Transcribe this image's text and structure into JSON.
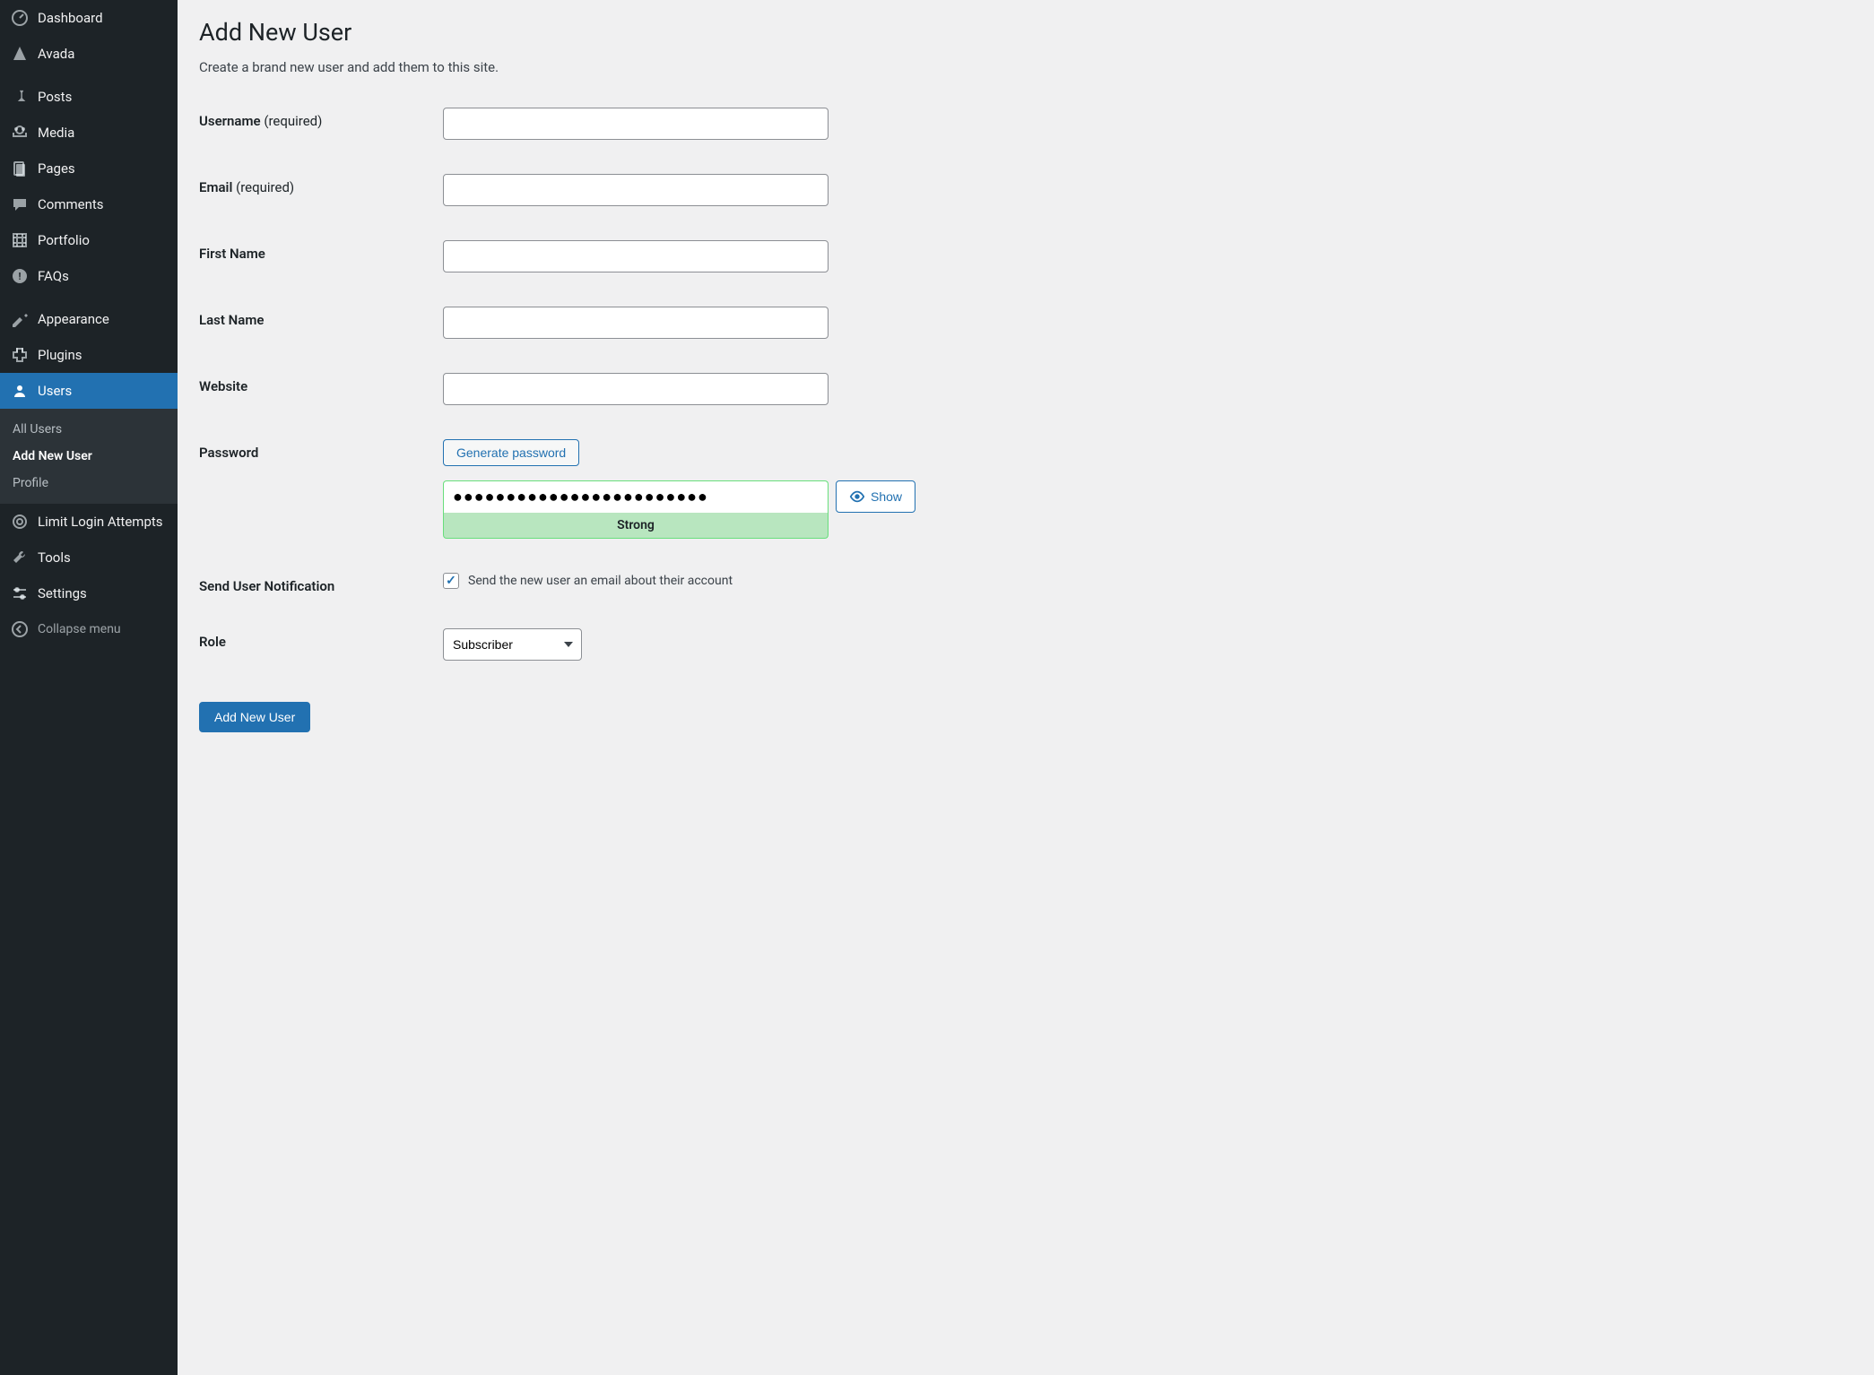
{
  "sidebar": {
    "items": [
      {
        "label": "Dashboard",
        "icon": "dashboard"
      },
      {
        "label": "Avada",
        "icon": "avada"
      },
      {
        "label": "Posts",
        "icon": "pin"
      },
      {
        "label": "Media",
        "icon": "media"
      },
      {
        "label": "Pages",
        "icon": "pages"
      },
      {
        "label": "Comments",
        "icon": "comments"
      },
      {
        "label": "Portfolio",
        "icon": "portfolio"
      },
      {
        "label": "FAQs",
        "icon": "faqs"
      },
      {
        "label": "Appearance",
        "icon": "appearance"
      },
      {
        "label": "Plugins",
        "icon": "plugins"
      },
      {
        "label": "Users",
        "icon": "users",
        "active": true
      },
      {
        "label": "Limit Login Attempts",
        "icon": "limit-login"
      },
      {
        "label": "Tools",
        "icon": "tools"
      },
      {
        "label": "Settings",
        "icon": "settings"
      }
    ],
    "submenu": [
      {
        "label": "All Users"
      },
      {
        "label": "Add New User",
        "current": true
      },
      {
        "label": "Profile"
      }
    ],
    "collapse": "Collapse menu"
  },
  "page": {
    "title": "Add New User",
    "subtitle": "Create a brand new user and add them to this site."
  },
  "form": {
    "username_label": "Username",
    "required_text": "(required)",
    "email_label": "Email",
    "first_name_label": "First Name",
    "last_name_label": "Last Name",
    "website_label": "Website",
    "password_label": "Password",
    "generate_password": "Generate password",
    "password_value": "●●●●●●●●●●●●●●●●●●●●●●●●",
    "password_strength": "Strong",
    "show_button": "Show",
    "send_notification_label": "Send User Notification",
    "send_notification_text": "Send the new user an email about their account",
    "role_label": "Role",
    "role_value": "Subscriber",
    "submit": "Add New User"
  }
}
